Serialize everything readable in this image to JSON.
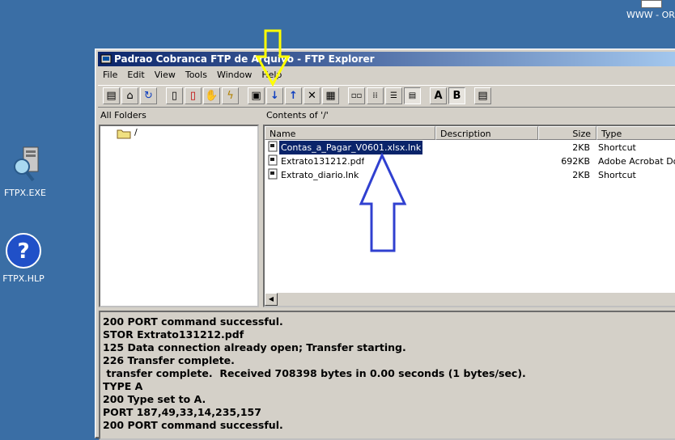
{
  "desktop": {
    "top_right_label": "WWW - ORI",
    "icons": [
      {
        "label": "FTPX.EXE",
        "icon": "computer-search-icon"
      },
      {
        "label": "FTPX.HLP",
        "icon": "help-icon"
      }
    ]
  },
  "window": {
    "title": "Padrao Cobranca FTP de Arquivo - FTP Explorer",
    "menu": [
      "File",
      "Edit",
      "View",
      "Tools",
      "Window",
      "Help"
    ],
    "toolbar_icons": [
      "connect-icon",
      "open-folder-icon",
      "refresh-icon",
      "new-file-icon",
      "delete-file-icon",
      "stop-hand-icon",
      "lightning-icon",
      "save-icon",
      "download-arrow-icon",
      "upload-arrow-icon",
      "delete-x-icon",
      "properties-icon",
      "large-icons-view-icon",
      "small-icons-view-icon",
      "list-view-icon",
      "details-view-icon",
      "ascii-mode-icon",
      "binary-mode-icon",
      "log-icon"
    ],
    "ascii_label": "A",
    "binary_label": "B",
    "folders_header": "All Folders",
    "tree_root": "/",
    "contents_header": "Contents of '/'",
    "columns": {
      "name": "Name",
      "description": "Description",
      "size": "Size",
      "type": "Type"
    },
    "files": [
      {
        "name": "Contas_a_Pagar_V0601.xlsx.lnk",
        "size": "2KB",
        "type": "Shortcut",
        "selected": true
      },
      {
        "name": "Extrato131212.pdf",
        "size": "692KB",
        "type": "Adobe Acrobat Do...",
        "selected": false
      },
      {
        "name": "Extrato_diario.lnk",
        "size": "2KB",
        "type": "Shortcut",
        "selected": false
      }
    ],
    "log_lines": [
      "200 PORT command successful.",
      "STOR Extrato131212.pdf",
      "125 Data connection already open; Transfer starting.",
      "226 Transfer complete.",
      " transfer complete.  Received 708398 bytes in 0.00 seconds (1 bytes/sec).",
      "TYPE A",
      "200 Type set to A.",
      "PORT 187,49,33,14,235,157",
      "200 PORT command successful."
    ]
  },
  "annotations": {
    "yellow_color": "#ffff00",
    "blue_color": "#3040d0"
  }
}
